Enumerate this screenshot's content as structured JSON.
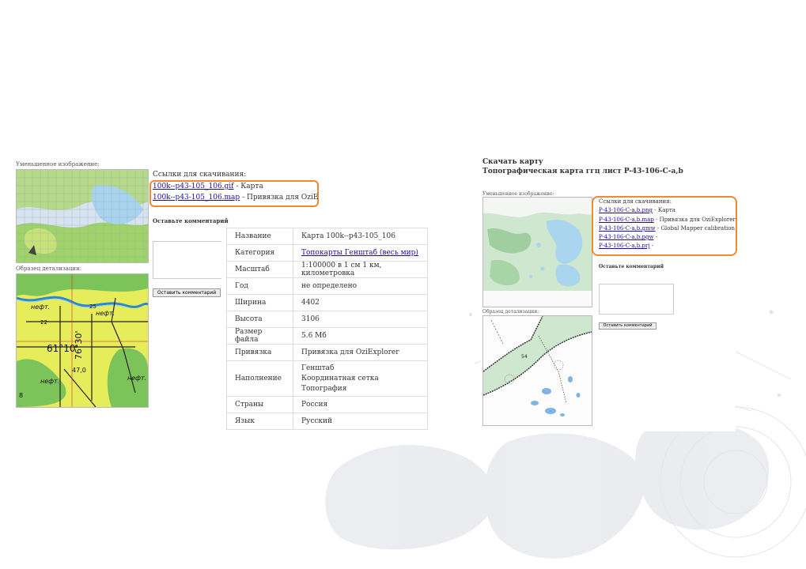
{
  "left": {
    "thumb_label": "Уменьшенное изображение:",
    "detail_label": "Образец детализации:",
    "links_title": "Ссылки для скачивания:",
    "links": [
      {
        "text": "100k--p43-105_106.gif",
        "desc": " - Карта"
      },
      {
        "text": "100k--p43-105_106.map",
        "desc": " - Привязка для OziE"
      }
    ],
    "comment_title": "Оставьте комментарий",
    "comment_button": "Оставить комментарий",
    "map_labels": [
      "нефт.",
      "нефт.",
      "25",
      "22",
      "61°10'",
      "76°30'",
      "47,0",
      "нефт.",
      "нефт.",
      "8"
    ],
    "info": [
      {
        "key": "Название",
        "value": "Карта 100k--p43-105_106"
      },
      {
        "key": "Категория",
        "value": "Топокарты Генштаб (весь мир)",
        "link": true
      },
      {
        "key": "Масштаб",
        "value": "1:100000 в 1 см 1 км, километровка"
      },
      {
        "key": "Год",
        "value": "не определено"
      },
      {
        "key": "Ширина",
        "value": "4402"
      },
      {
        "key": "Высота",
        "value": "3106"
      },
      {
        "key": "Размер файла",
        "value": "5.6 Мб"
      },
      {
        "key": "Привязка",
        "value": "Привязка для OziExplorer"
      },
      {
        "key": "Наполнение",
        "values": [
          "Генштаб",
          "Координатная сетка",
          "Топография"
        ]
      },
      {
        "key": "Страны",
        "value": "Россия"
      },
      {
        "key": "Язык",
        "value": "Русский"
      }
    ]
  },
  "right": {
    "download_title": "Скачать карту",
    "map_title": "Топографическая карта ггц лист P-43-106-C-a,b",
    "thumb_label": "Уменьшенное изображение:",
    "detail_label": "Образец детализации:",
    "links_title": "Ссылки для скачивания:",
    "links": [
      {
        "text": "P-43-106-C-a,b.png",
        "desc": " - Карта"
      },
      {
        "text": "P-43-106-C-a,b.map",
        "desc": " - Привязка для OziExplorer"
      },
      {
        "text": "P-43-106-C-a,b.gmw",
        "desc": " - Global Mapper calibration"
      },
      {
        "text": "P-43-106-C-a,b.pgw",
        "desc": " -"
      },
      {
        "text": "P-43-106-C-a,b.prj",
        "desc": " -"
      }
    ],
    "comment_title": "Оставьте комментарий",
    "comment_button": "Оставить комментарий",
    "detail_number": "54"
  },
  "colors": {
    "highlight": "#f08a2c",
    "link": "#1a0dab",
    "map_yellow": "#e6ec5a",
    "map_green": "#7cc45a",
    "map_blue": "#9ad0ec",
    "map_green_light": "#cfe6cf"
  }
}
